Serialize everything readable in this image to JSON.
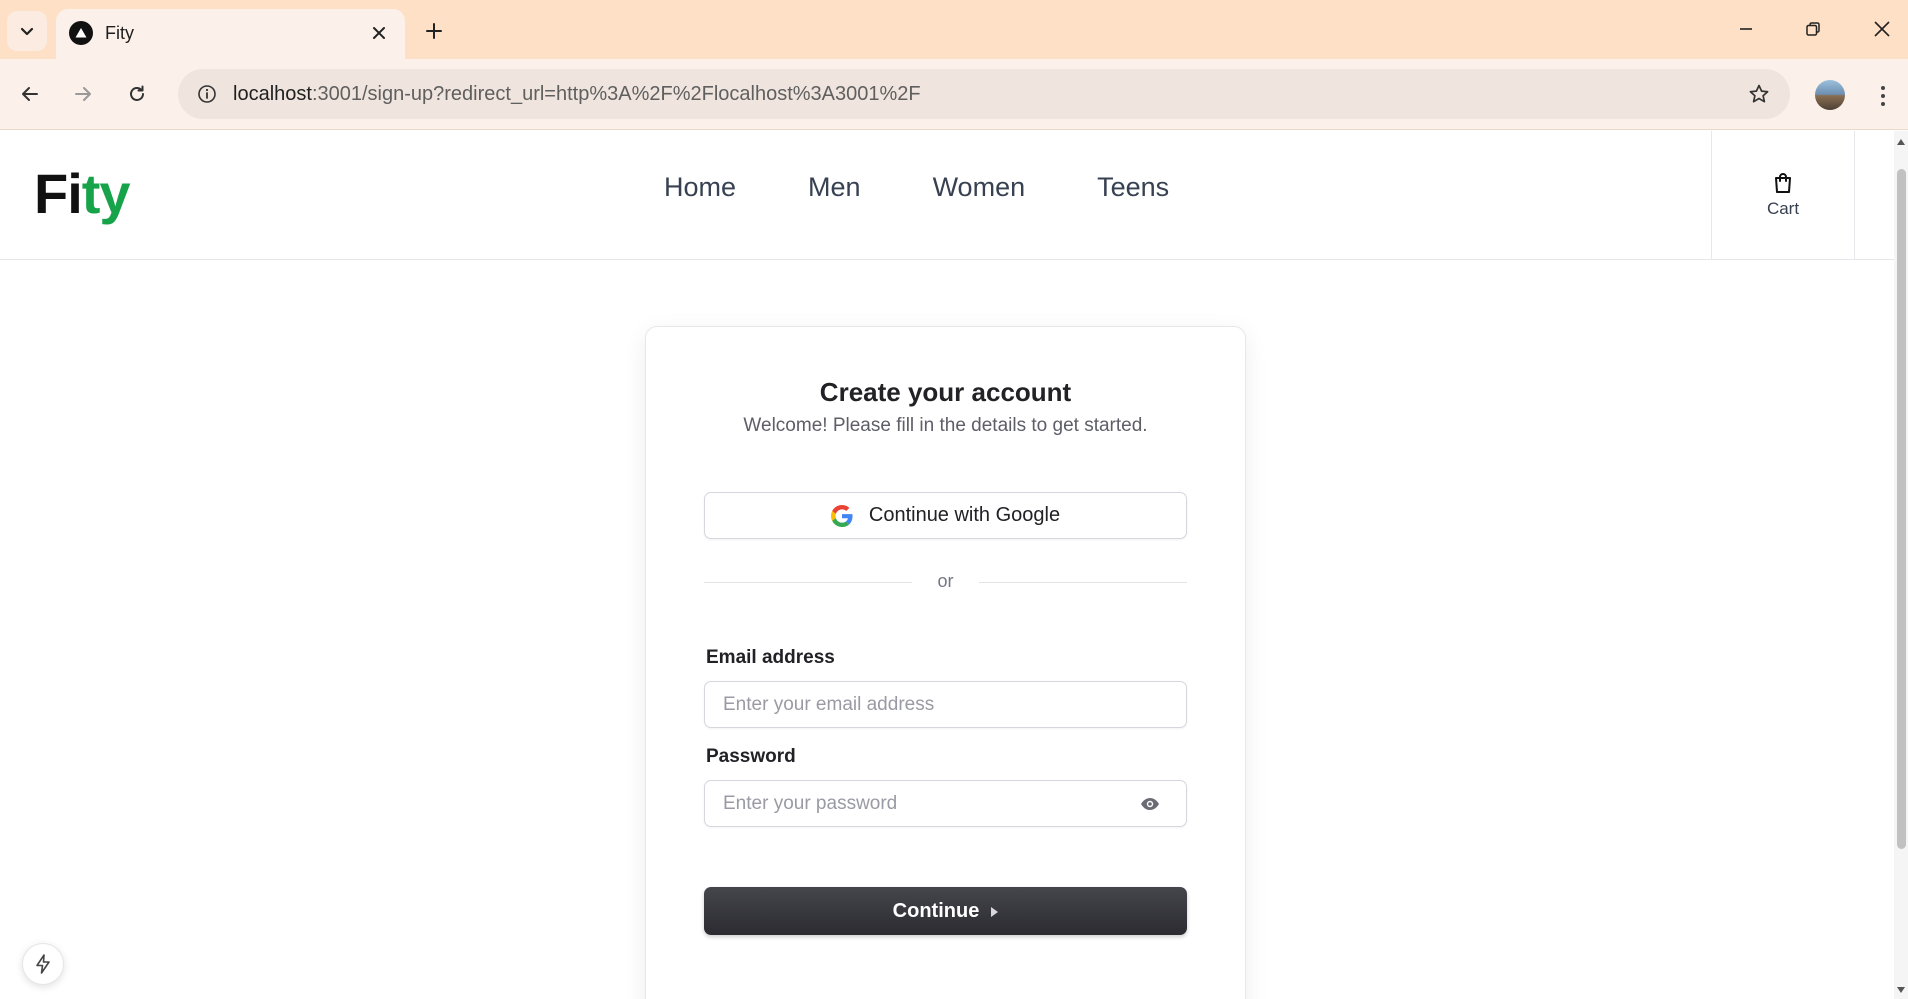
{
  "browser": {
    "tab": {
      "title": "Fity",
      "favicon": "triangle-logo-icon"
    },
    "url": {
      "host": "localhost",
      "rest": ":3001/sign-up?redirect_url=http%3A%2F%2Flocalhost%3A3001%2F"
    },
    "icons": [
      "tab-list-icon",
      "close-icon",
      "plus-icon",
      "minimize-icon",
      "restore-icon",
      "window-close-icon",
      "back-icon",
      "forward-icon",
      "reload-icon",
      "site-info-icon",
      "star-icon",
      "avatar",
      "more-vert-icon"
    ]
  },
  "header": {
    "logo": {
      "part1": "Fi",
      "part2": "ty"
    },
    "nav": [
      "Home",
      "Men",
      "Women",
      "Teens"
    ],
    "cart_label": "Cart"
  },
  "signup": {
    "title": "Create your account",
    "subtitle": "Welcome! Please fill in the details to get started.",
    "google_label": "Continue with Google",
    "divider_text": "or",
    "email_label": "Email address",
    "email_placeholder": "Enter your email address",
    "password_label": "Password",
    "password_placeholder": "Enter your password",
    "continue_label": "Continue"
  },
  "colors": {
    "brand_green": "#16a34a",
    "tabstrip": "#fde0c5",
    "button_dark": "#2b2b31"
  }
}
